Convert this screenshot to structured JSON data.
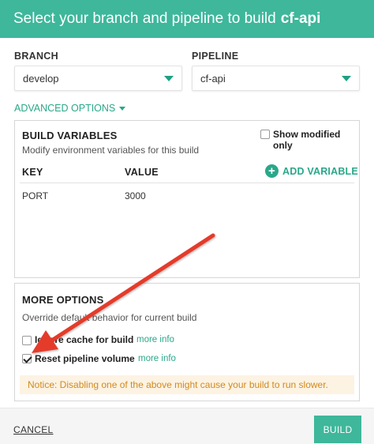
{
  "header": {
    "title_prefix": "Select your branch and pipeline to build",
    "title_name": "cf-api"
  },
  "branch": {
    "label": "BRANCH",
    "value": "develop"
  },
  "pipeline": {
    "label": "PIPELINE",
    "value": "cf-api"
  },
  "advanced_options": {
    "label": "ADVANCED OPTIONS"
  },
  "build_variables": {
    "title": "BUILD VARIABLES",
    "subtitle": "Modify environment variables for this build",
    "show_modified_label": "Show modified only",
    "show_modified_checked": false,
    "columns": {
      "key": "KEY",
      "value": "VALUE"
    },
    "add_variable_label": "ADD VARIABLE",
    "rows": [
      {
        "key": "PORT",
        "value": "3000"
      }
    ]
  },
  "more_options": {
    "title": "MORE OPTIONS",
    "subtitle": "Override default behavior for current build",
    "options": [
      {
        "label": "Ignore cache for build",
        "checked": false,
        "more_info": "more info"
      },
      {
        "label": "Reset pipeline volume",
        "checked": true,
        "more_info": "more info"
      }
    ],
    "notice": "Notice: Disabling one of the above might cause your build to run slower."
  },
  "footer": {
    "cancel_label": "CANCEL",
    "build_label": "BUILD"
  },
  "colors": {
    "accent": "#3eb79b",
    "annotation_arrow": "#e53b2c",
    "notice_bg": "#fdf3e3",
    "notice_text": "#d08a1e"
  },
  "annotation": {
    "icon": "red-arrow"
  }
}
